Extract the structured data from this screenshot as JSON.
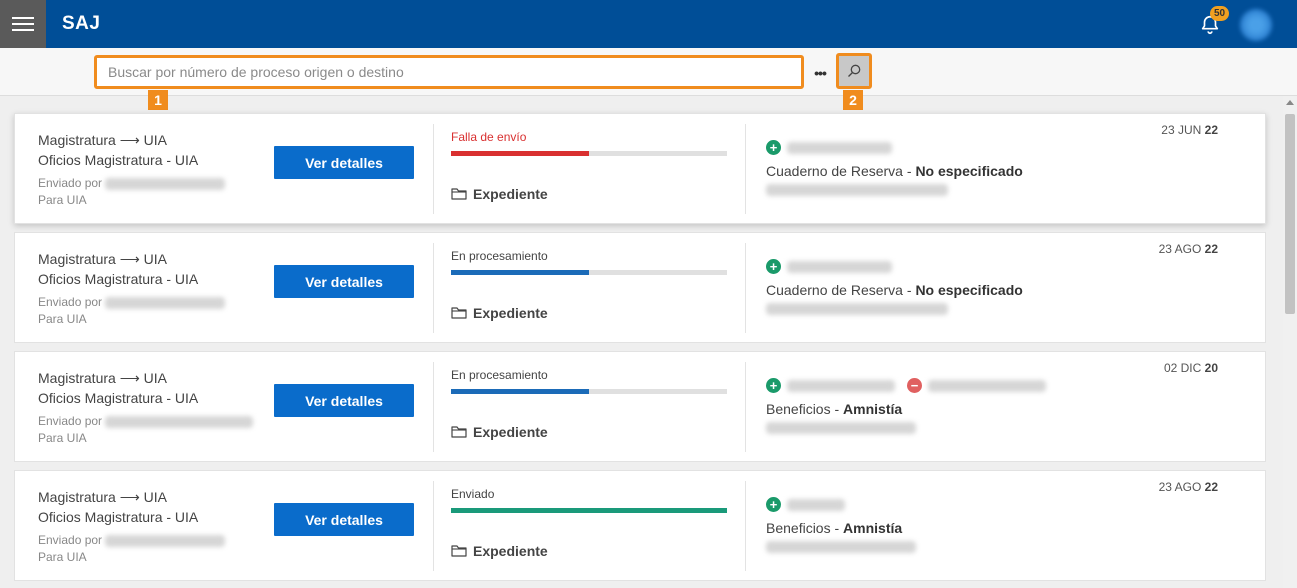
{
  "header": {
    "app_title": "SAJ",
    "notification_count": "50"
  },
  "search": {
    "placeholder": "Buscar por número de proceso origen o destino",
    "more_label": "•••",
    "marker_1": "1",
    "marker_2": "2"
  },
  "colors": {
    "header_bg": "#004e97",
    "accent_orange": "#f08c1e",
    "button_blue": "#0a6ccb",
    "status_error": "#d93030",
    "status_processing": "#1b6bb8",
    "status_sent": "#1a9a7a"
  },
  "common": {
    "details_button": "Ver detalles",
    "expediente_label": "Expediente",
    "sent_by_label": "Enviado por",
    "recipient_label": "Para UIA",
    "route": "Magistratura ⟶ UIA",
    "oficio": "Oficios Magistratura - UIA"
  },
  "cards": [
    {
      "status": "Falla de envío",
      "status_color": "#d93030",
      "progress": 0.5,
      "progress_color": "#d93030",
      "date_day_month": "23 JUN",
      "date_year": "22",
      "category": "Cuaderno de Reserva",
      "category_value": "No especificado",
      "parties": [
        "plus"
      ]
    },
    {
      "status": "En procesamiento",
      "status_color": "#444444",
      "progress": 0.5,
      "progress_color": "#1b6bb8",
      "date_day_month": "23 AGO",
      "date_year": "22",
      "category": "Cuaderno de Reserva",
      "category_value": "No especificado",
      "parties": [
        "plus"
      ]
    },
    {
      "status": "En procesamiento",
      "status_color": "#444444",
      "progress": 0.5,
      "progress_color": "#1b6bb8",
      "date_day_month": "02 DIC",
      "date_year": "20",
      "category": "Beneficios",
      "category_value": "Amnistía",
      "parties": [
        "plus",
        "minus"
      ]
    },
    {
      "status": "Enviado",
      "status_color": "#444444",
      "progress": 1.0,
      "progress_color": "#1a9a7a",
      "date_day_month": "23 AGO",
      "date_year": "22",
      "category": "Beneficios",
      "category_value": "Amnistía",
      "parties": [
        "plus"
      ]
    }
  ]
}
